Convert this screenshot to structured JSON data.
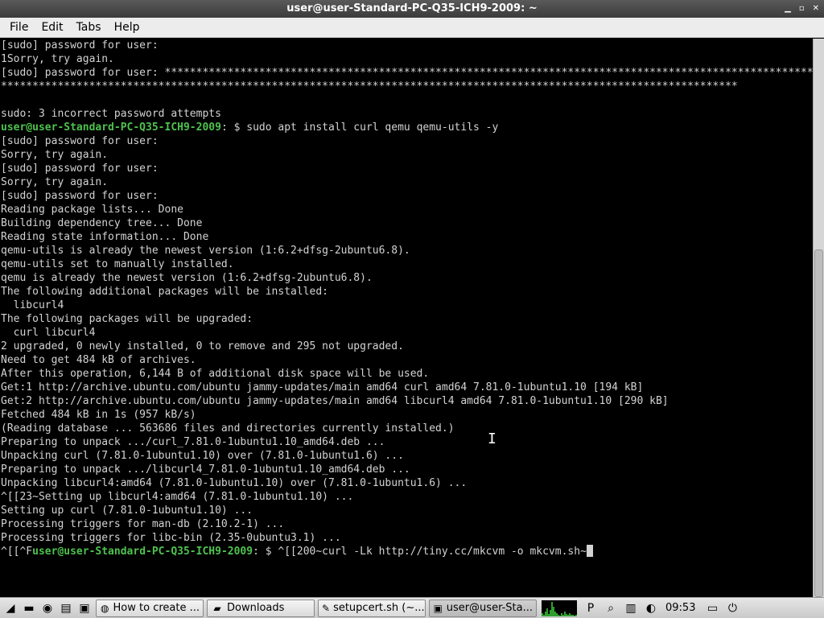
{
  "window": {
    "title": "user@user-Standard-PC-Q35-ICH9-2009: ~",
    "controls": [
      "▁",
      "▫",
      "✕"
    ]
  },
  "menubar": {
    "items": [
      "File",
      "Edit",
      "Tabs",
      "Help"
    ]
  },
  "terminal": {
    "lines": [
      {
        "text": "[sudo] password for user:"
      },
      {
        "text": "1Sorry, try again."
      },
      {
        "text": "[sudo] password for user: ******************************************************************************************************************************"
      },
      {
        "text": "*********************************************************************************************************************"
      },
      {
        "text": ""
      },
      {
        "text": "sudo: 3 incorrect password attempts"
      },
      {
        "prompt": "user@user-Standard-PC-Q35-ICH9-2009",
        "text": ": $ sudo apt install curl qemu qemu-utils -y"
      },
      {
        "text": "[sudo] password for user:"
      },
      {
        "text": "Sorry, try again."
      },
      {
        "text": "[sudo] password for user:"
      },
      {
        "text": "Sorry, try again."
      },
      {
        "text": "[sudo] password for user:"
      },
      {
        "text": "Reading package lists... Done"
      },
      {
        "text": "Building dependency tree... Done"
      },
      {
        "text": "Reading state information... Done"
      },
      {
        "text": "qemu-utils is already the newest version (1:6.2+dfsg-2ubuntu6.8)."
      },
      {
        "text": "qemu-utils set to manually installed."
      },
      {
        "text": "qemu is already the newest version (1:6.2+dfsg-2ubuntu6.8)."
      },
      {
        "text": "The following additional packages will be installed:"
      },
      {
        "text": "  libcurl4"
      },
      {
        "text": "The following packages will be upgraded:"
      },
      {
        "text": "  curl libcurl4"
      },
      {
        "text": "2 upgraded, 0 newly installed, 0 to remove and 295 not upgraded."
      },
      {
        "text": "Need to get 484 kB of archives."
      },
      {
        "text": "After this operation, 6,144 B of additional disk space will be used."
      },
      {
        "text": "Get:1 http://archive.ubuntu.com/ubuntu jammy-updates/main amd64 curl amd64 7.81.0-1ubuntu1.10 [194 kB]"
      },
      {
        "text": "Get:2 http://archive.ubuntu.com/ubuntu jammy-updates/main amd64 libcurl4 amd64 7.81.0-1ubuntu1.10 [290 kB]"
      },
      {
        "text": "Fetched 484 kB in 1s (957 kB/s)"
      },
      {
        "text": "(Reading database ... 563686 files and directories currently installed.)"
      },
      {
        "text": "Preparing to unpack .../curl_7.81.0-1ubuntu1.10_amd64.deb ..."
      },
      {
        "text": "Unpacking curl (7.81.0-1ubuntu1.10) over (7.81.0-1ubuntu1.6) ..."
      },
      {
        "text": "Preparing to unpack .../libcurl4_7.81.0-1ubuntu1.10_amd64.deb ..."
      },
      {
        "text": "Unpacking libcurl4:amd64 (7.81.0-1ubuntu1.10) over (7.81.0-1ubuntu1.6) ..."
      },
      {
        "text": "^[[23~Setting up libcurl4:amd64 (7.81.0-1ubuntu1.10) ..."
      },
      {
        "text": "Setting up curl (7.81.0-1ubuntu1.10) ..."
      },
      {
        "text": "Processing triggers for man-db (2.10.2-1) ..."
      },
      {
        "text": "Processing triggers for libc-bin (2.35-0ubuntu3.1) ..."
      },
      {
        "pre": "^[[^F",
        "prompt": "user@user-Standard-PC-Q35-ICH9-2009",
        "text": ": $ ^[[200~curl -Lk http://tiny.cc/mkcvm -o mkcvm.sh~",
        "cursor": true
      }
    ]
  },
  "taskbar": {
    "launchers": [
      {
        "name": "menu-icon",
        "glyph": "◢"
      },
      {
        "name": "show-desktop-icon",
        "glyph": "▬"
      },
      {
        "name": "network-icon",
        "glyph": "◉"
      },
      {
        "name": "files-icon",
        "glyph": "▤"
      },
      {
        "name": "terminal-icon",
        "glyph": "▣"
      }
    ],
    "tasks": [
      {
        "name": "task-browser",
        "icon": "◍",
        "label": "How to create ...",
        "active": false
      },
      {
        "name": "task-downloads",
        "icon": "▰",
        "label": "Downloads",
        "active": false
      },
      {
        "name": "task-editor",
        "icon": "✎",
        "label": "setupcert.sh (~...",
        "active": false
      },
      {
        "name": "task-terminal",
        "icon": "▣",
        "label": "user@user-Sta...",
        "active": true
      }
    ],
    "tray_icons": [
      {
        "name": "p-icon",
        "glyph": "P"
      },
      {
        "name": "search-icon",
        "glyph": "⌕"
      },
      {
        "name": "clipboard-icon",
        "glyph": "▥"
      },
      {
        "name": "network-status-icon",
        "glyph": "◐"
      }
    ],
    "clock": "09:53",
    "end_icons": [
      {
        "name": "window-list-icon",
        "glyph": "▭"
      },
      {
        "name": "power-icon",
        "glyph": "⏻"
      }
    ],
    "cpu_levels": [
      0.2,
      0.1,
      0.3,
      0.5,
      0.15,
      0.4,
      0.9,
      0.6,
      0.3,
      0.2,
      0.1,
      0.05,
      0.2,
      0.1,
      0.3,
      0.15,
      0.1,
      0.2,
      0.1,
      0.1,
      0.05,
      0.1
    ]
  },
  "colors": {
    "prompt": "#4ec24e",
    "text": "#d3d3d3",
    "background": "#000000"
  }
}
